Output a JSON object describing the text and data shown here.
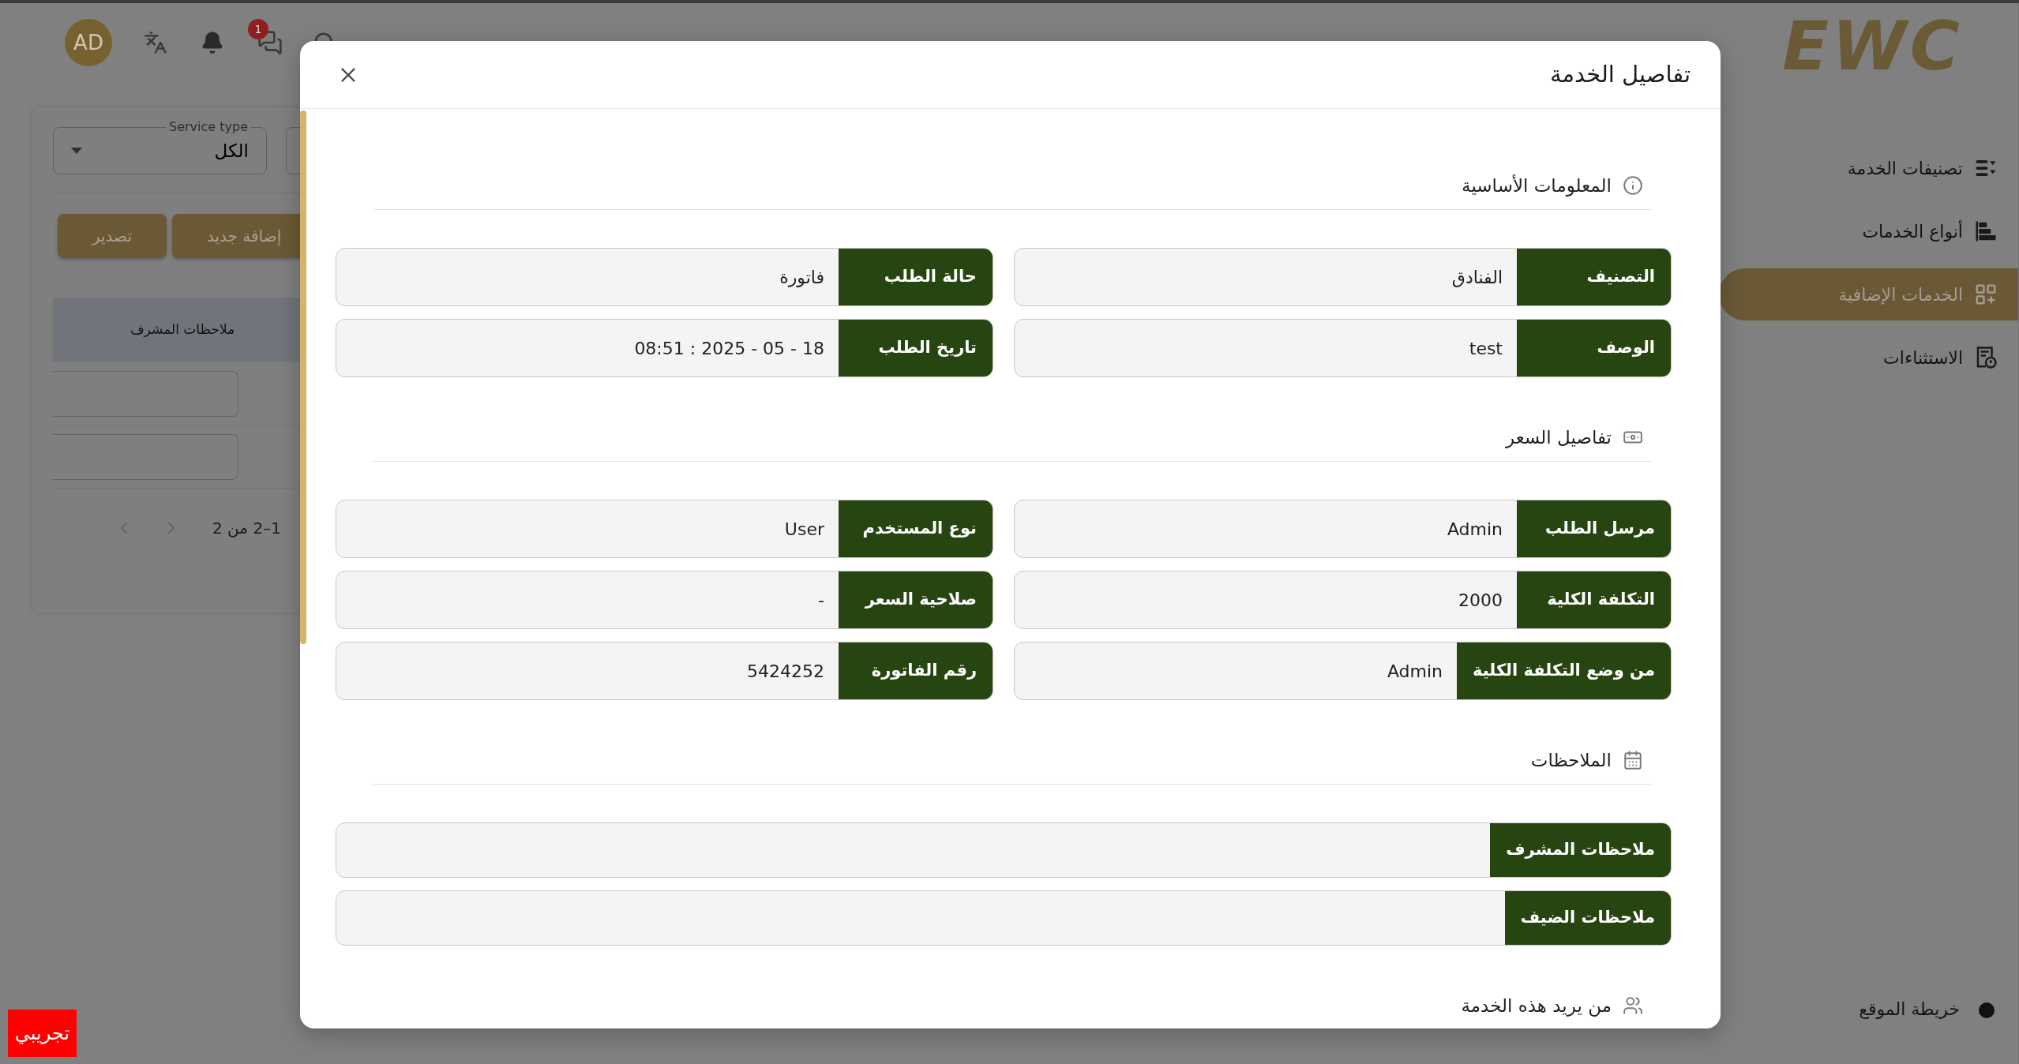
{
  "header": {
    "avatar": "AD",
    "notification_badge": "1"
  },
  "filter": {
    "label": "Service type",
    "value": "الكل"
  },
  "actions": [
    "إضافة جديد",
    "تصدير"
  ],
  "table": {
    "columns": [
      "ملاحظات المشرف"
    ],
    "rows": [
      {
        "kind": "input"
      },
      {
        "kind": "input"
      }
    ],
    "pagination": "1–2 من 2"
  },
  "sidebar": {
    "logo": "EWC",
    "items": [
      {
        "label": "تصنيفات الخدمة",
        "selected": false
      },
      {
        "label": "أنواع الخدمات",
        "selected": false
      },
      {
        "label": "الخدمات الإضافية",
        "selected": true
      },
      {
        "label": "الاستثناءات",
        "selected": false
      }
    ],
    "footer": "خريطة الموقع"
  },
  "modal": {
    "title": "تفاصيل الخدمة",
    "sections": [
      {
        "title": "المعلومات الأساسية",
        "kind": "pairs",
        "rows": [
          {
            "label": "التصنيف",
            "value": "الفنادق"
          },
          {
            "label": "حالة الطلب",
            "value": "فاتورة"
          },
          {
            "label": "الوصف",
            "value": "test"
          },
          {
            "label": "تاريخ الطلب",
            "value": "08:51 : 2025 - 05 - 18"
          }
        ]
      },
      {
        "title": "تفاصيل السعر",
        "kind": "pairs",
        "rows": [
          {
            "label": "مرسل الطلب",
            "value": "Admin"
          },
          {
            "label": "نوع المستخدم",
            "value": "User"
          },
          {
            "label": "التكلفة الكلية",
            "value": "2000"
          },
          {
            "label": "صلاحية السعر",
            "value": "-"
          },
          {
            "label": "من وضع التكلفة الكلية",
            "value": "Admin"
          },
          {
            "label": "رقم الفاتورة",
            "value": "5424252"
          }
        ]
      },
      {
        "title": "الملاحظات",
        "kind": "notes",
        "rows": [
          {
            "label": "ملاحظات المشرف"
          },
          {
            "label": "ملاحظات الضيف"
          }
        ]
      },
      {
        "title": "من يريد هذه الخدمة",
        "kind": "notes"
      }
    ]
  },
  "demo_badge": "تجريبي"
}
